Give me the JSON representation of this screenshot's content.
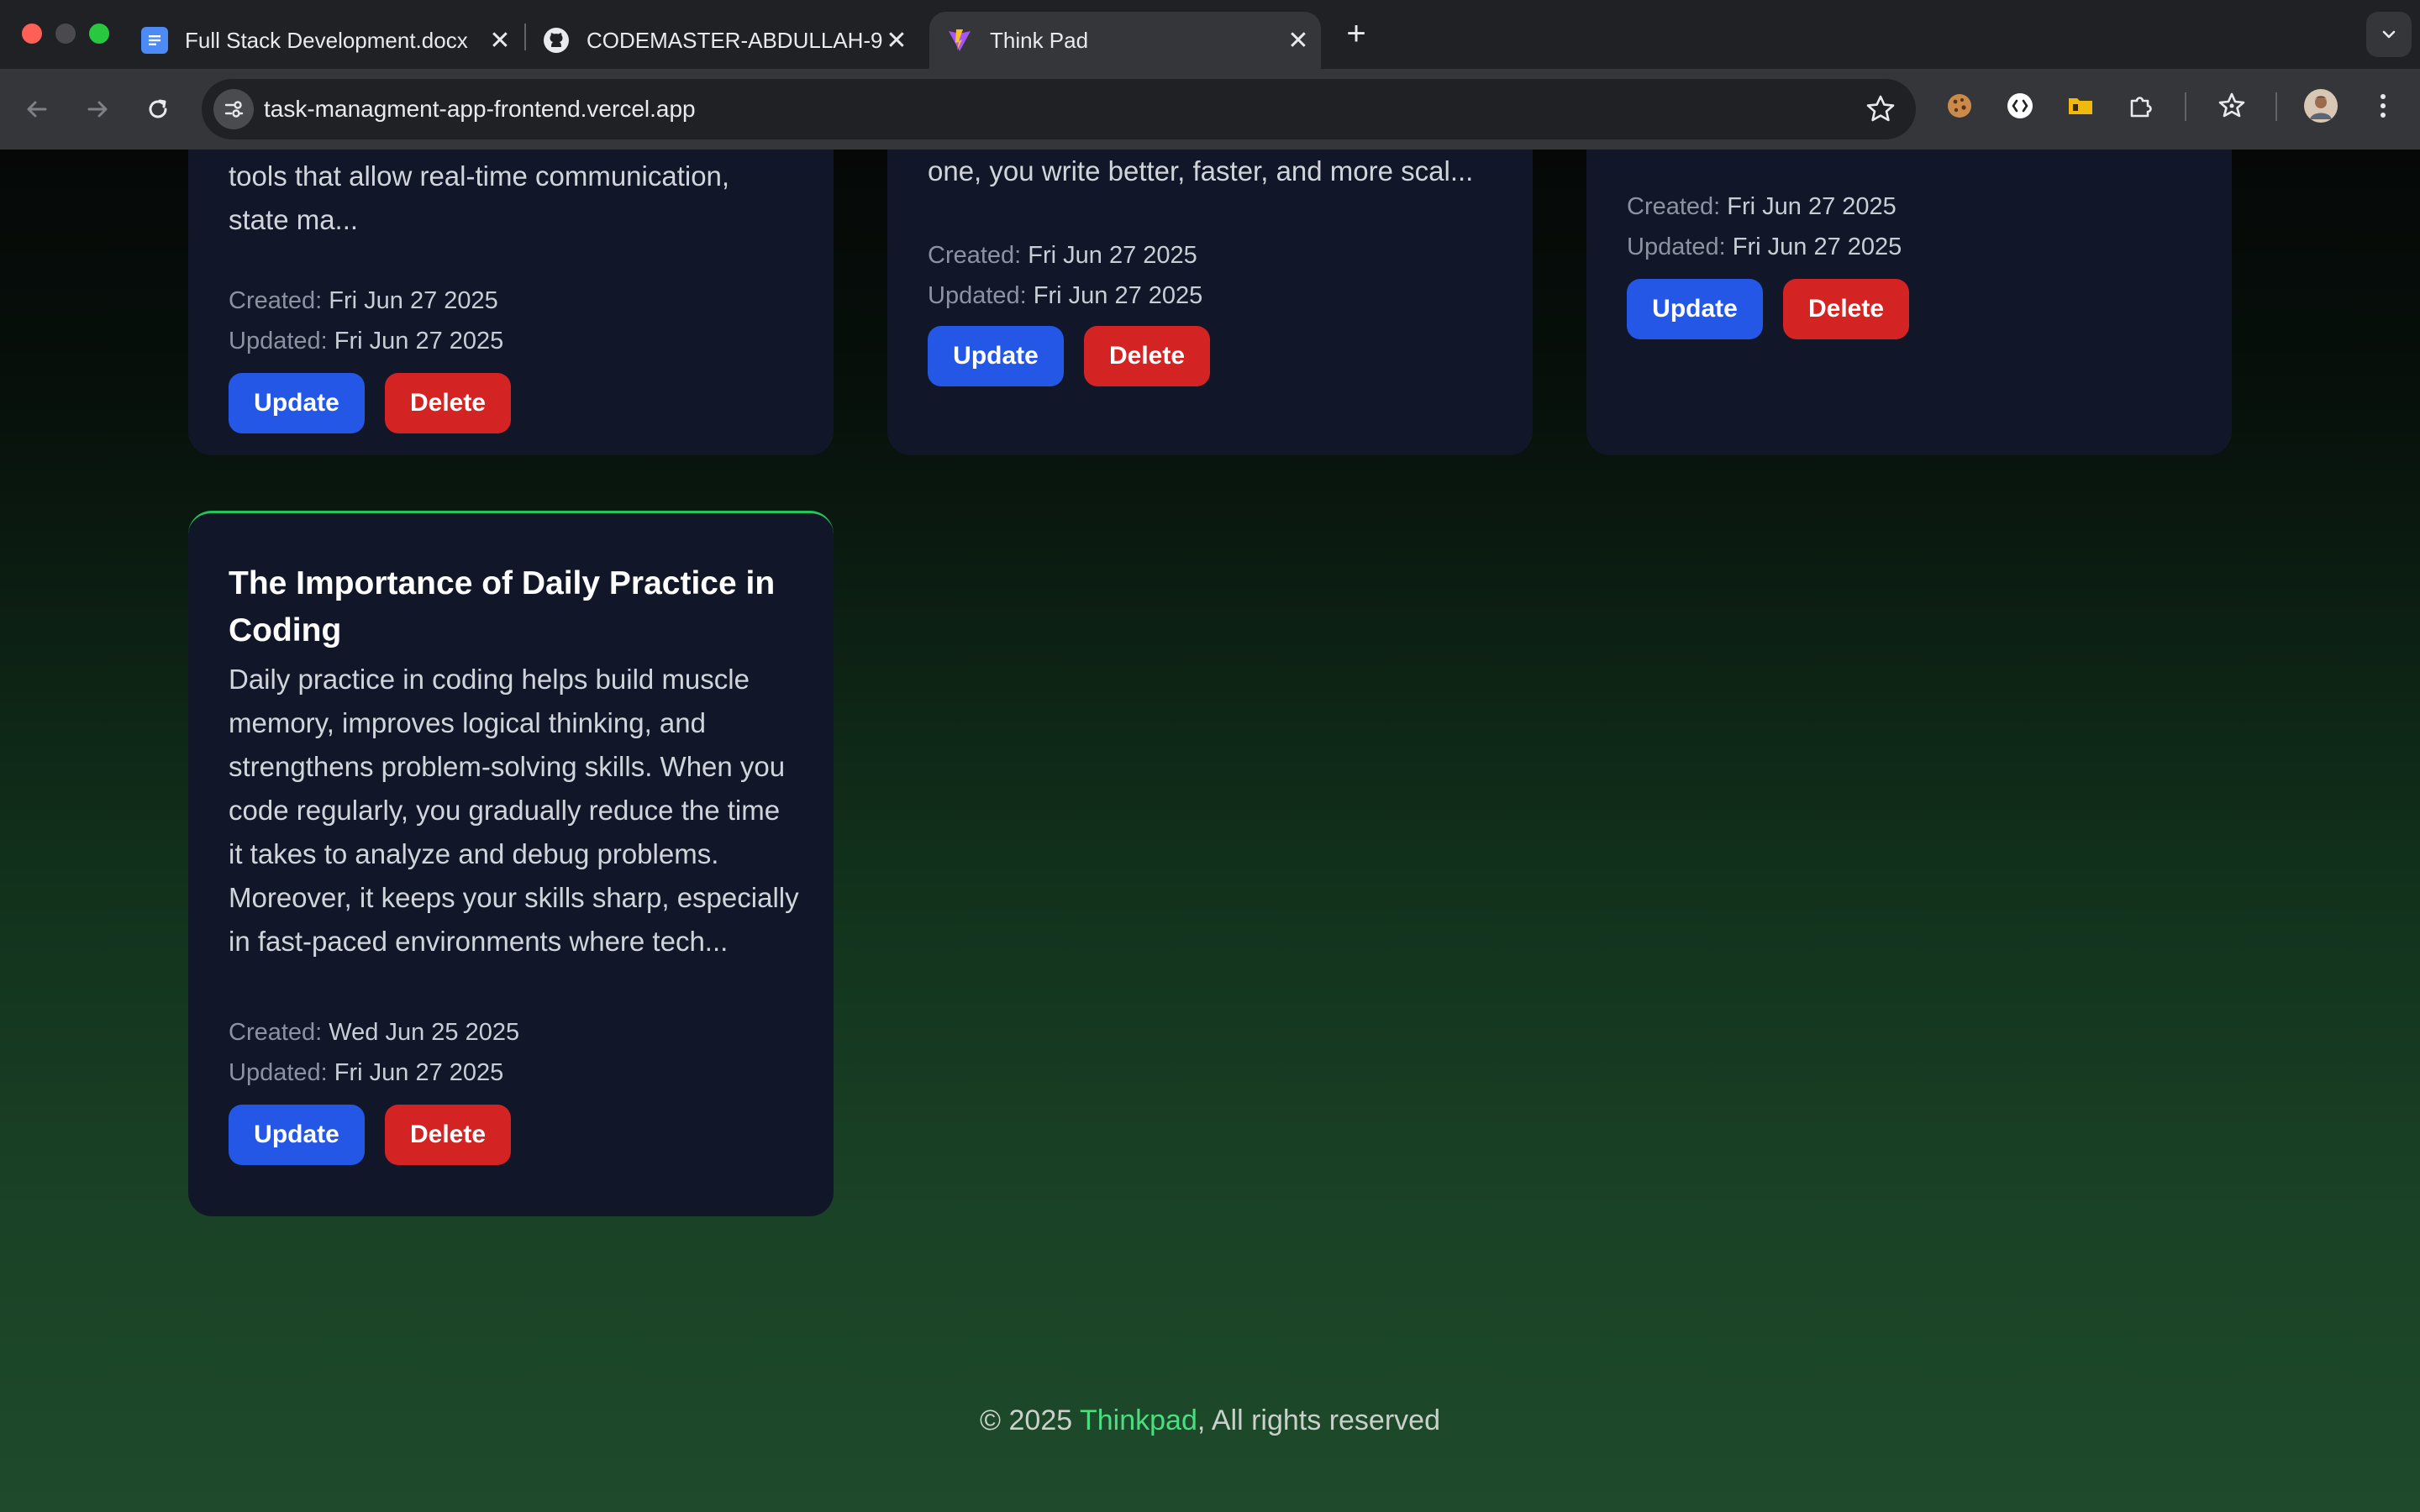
{
  "browser": {
    "tabs": [
      {
        "title": "Full Stack Development.docx",
        "icon": "google-docs-icon"
      },
      {
        "title": "CODEMASTER-ABDULLAH-9",
        "icon": "github-icon"
      },
      {
        "title": "Think Pad",
        "icon": "vite-icon",
        "active": true
      }
    ],
    "url": "task-managment-app-frontend.vercel.app"
  },
  "cards_top": [
    {
      "text_lines": [
        "tools that allow real-time communication,",
        "state ma..."
      ],
      "created_label": "Created:",
      "created": "Fri Jun 27 2025",
      "updated_label": "Updated:",
      "updated": "Fri Jun 27 2025",
      "update_label": "Update",
      "delete_label": "Delete"
    },
    {
      "text_lines": [
        "one, you write better, faster, and more scal..."
      ],
      "created_label": "Created:",
      "created": "Fri Jun 27 2025",
      "updated_label": "Updated:",
      "updated": "Fri Jun 27 2025",
      "update_label": "Update",
      "delete_label": "Delete"
    },
    {
      "text_lines": [],
      "created_label": "Created:",
      "created": "Fri Jun 27 2025",
      "updated_label": "Updated:",
      "updated": "Fri Jun 27 2025",
      "update_label": "Update",
      "delete_label": "Delete"
    }
  ],
  "card_main": {
    "title_lines": [
      "The Importance of Daily Practice in",
      "Coding"
    ],
    "text_lines": [
      "Daily practice in coding helps build muscle",
      "memory, improves logical thinking, and",
      "strengthens problem-solving skills. When you",
      "code regularly, you gradually reduce the time",
      "it takes to analyze and debug problems.",
      "Moreover, it keeps your skills sharp, especially",
      "in fast-paced environments where tech..."
    ],
    "created_label": "Created:",
    "created": "Wed Jun 25 2025",
    "updated_label": "Updated:",
    "updated": "Fri Jun 27 2025",
    "update_label": "Update",
    "delete_label": "Delete"
  },
  "footer": {
    "prefix": "© 2025 ",
    "brand": "Thinkpad",
    "suffix": ", All rights reserved"
  },
  "colors": {
    "card_bg": "#111729",
    "update_button": "#2457e6",
    "delete_button": "#d42323",
    "brand_green": "#4ade80"
  }
}
